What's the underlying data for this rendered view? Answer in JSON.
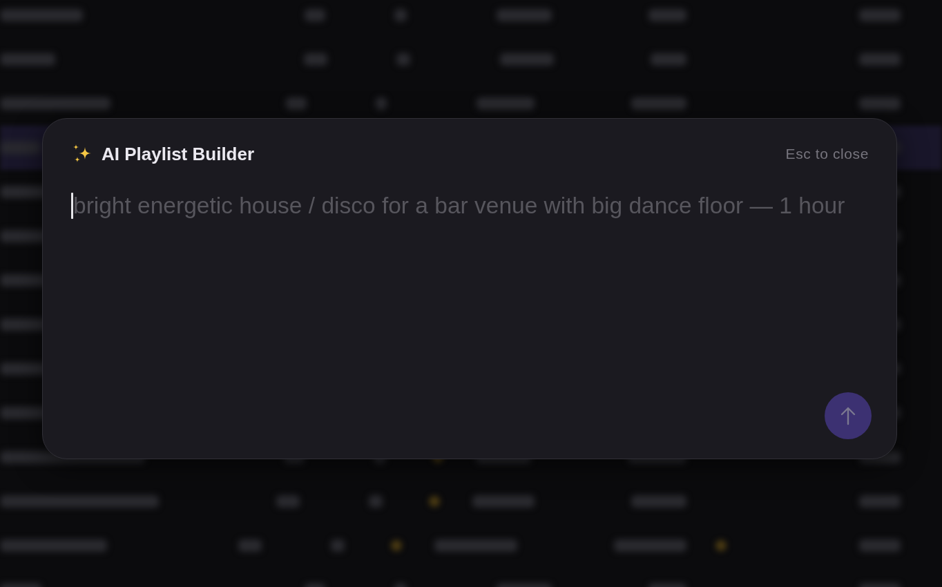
{
  "dialog": {
    "title": "AI Playlist Builder",
    "close_hint": "Esc to close",
    "prompt": {
      "placeholder": "bright energetic house / disco for a bar venue with big dance floor — 1 hour",
      "focused": true
    },
    "send_button": {
      "disabled": true
    }
  }
}
